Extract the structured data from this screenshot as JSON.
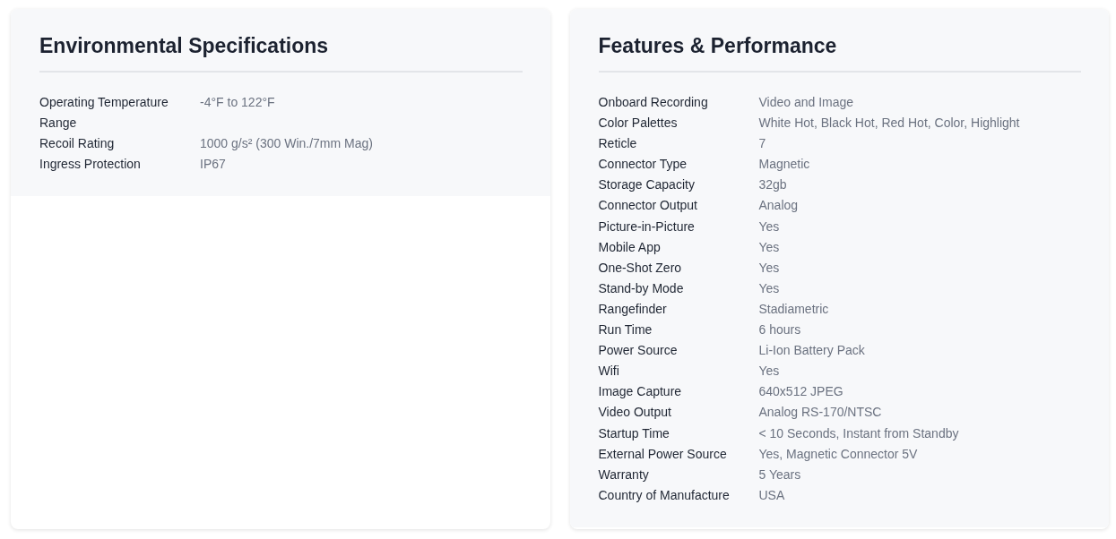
{
  "panels": [
    {
      "title": "Environmental Specifications",
      "specs": [
        {
          "label": "Operating Temperature Range",
          "value": "-4°F to 122°F"
        },
        {
          "label": "Recoil Rating",
          "value": "1000 g/s² (300 Win./7mm Mag)"
        },
        {
          "label": "Ingress Protection",
          "value": "IP67"
        }
      ]
    },
    {
      "title": "Features & Performance",
      "specs": [
        {
          "label": "Onboard Recording",
          "value": "Video and Image"
        },
        {
          "label": "Color Palettes",
          "value": "White Hot, Black Hot, Red Hot, Color, Highlight"
        },
        {
          "label": "Reticle",
          "value": "7"
        },
        {
          "label": "Connector Type",
          "value": "Magnetic"
        },
        {
          "label": "Storage Capacity",
          "value": "32gb"
        },
        {
          "label": "Connector Output",
          "value": "Analog"
        },
        {
          "label": "Picture-in-Picture",
          "value": "Yes"
        },
        {
          "label": "Mobile App",
          "value": "Yes"
        },
        {
          "label": "One-Shot Zero",
          "value": "Yes"
        },
        {
          "label": "Stand-by Mode",
          "value": "Yes"
        },
        {
          "label": "Rangefinder",
          "value": "Stadiametric"
        },
        {
          "label": "Run Time",
          "value": "6 hours"
        },
        {
          "label": "Power Source",
          "value": "Li-Ion Battery Pack"
        },
        {
          "label": "Wifi",
          "value": "Yes"
        },
        {
          "label": "Image Capture",
          "value": "640x512 JPEG"
        },
        {
          "label": "Video Output",
          "value": "Analog RS-170/NTSC"
        },
        {
          "label": "Startup Time",
          "value": "< 10 Seconds, Instant from Standby"
        },
        {
          "label": "External Power Source",
          "value": "Yes, Magnetic Connector 5V"
        },
        {
          "label": "Warranty",
          "value": "5 Years"
        },
        {
          "label": "Country of Manufacture",
          "value": "USA"
        }
      ]
    }
  ]
}
